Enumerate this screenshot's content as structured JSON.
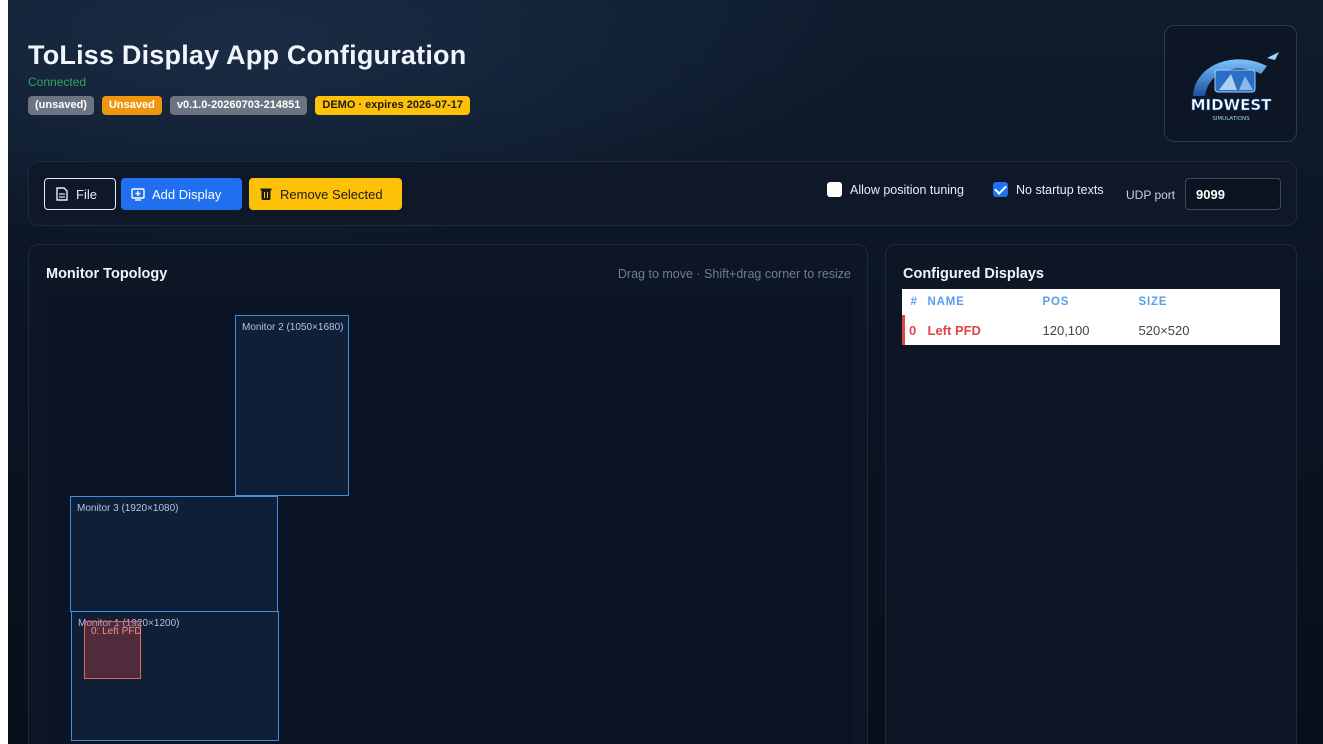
{
  "app": {
    "title": "ToLiss Display App Configuration",
    "connection_status": "Connected"
  },
  "badges": [
    {
      "label": "(unsaved)",
      "style": "gray"
    },
    {
      "label": "Unsaved",
      "style": "orange"
    },
    {
      "label": "v0.1.0-20260703-214851",
      "style": "gray"
    },
    {
      "label": "DEMO · expires 2026-07-17",
      "style": "yellow"
    }
  ],
  "logo": {
    "brand": "MIDWEST",
    "sub": "SIMULATIONS"
  },
  "toolbar": {
    "file_label": "File",
    "add_label": "Add Display",
    "remove_label": "Remove Selected",
    "allow_position_tuning": {
      "label": "Allow position tuning",
      "checked": false
    },
    "no_startup_texts": {
      "label": "No startup texts",
      "checked": true
    },
    "udp_label": "UDP port",
    "udp_value": "9099"
  },
  "topology": {
    "title": "Monitor Topology",
    "hint": "Drag to move · Shift+drag corner to resize",
    "monitors": [
      {
        "label": "Monitor 2 (1050×1680)"
      },
      {
        "label": "Monitor 3 (1920×1080)"
      },
      {
        "label": "Monitor 1 (1920×1200)"
      }
    ],
    "displays": [
      {
        "label": "0: Left PFD"
      }
    ]
  },
  "configured": {
    "title": "Configured Displays",
    "columns": [
      "#",
      "NAME",
      "POS",
      "SIZE"
    ],
    "rows": [
      {
        "idx": "0",
        "name": "Left PFD",
        "pos": "120,100",
        "size": "520×520"
      }
    ]
  },
  "colors": {
    "accent_blue": "#1f6ff0",
    "warning_yellow": "#ffc107",
    "unsaved_orange": "#f0960e",
    "connected_green": "#2fa65d",
    "selected_red": "#e04545"
  }
}
